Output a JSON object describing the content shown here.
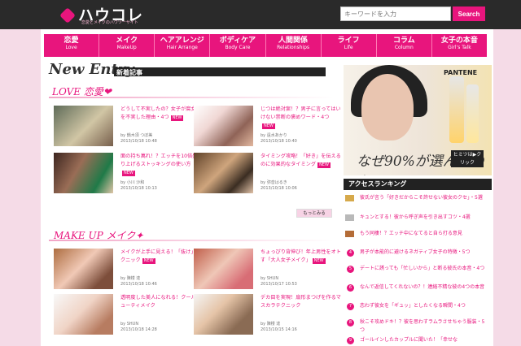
{
  "site": {
    "logo": "ハウコレ",
    "tagline": "恋愛とメイクのハウツーサイト",
    "search_placeholder": "キーワードを入力",
    "search_button": "Search"
  },
  "nav": [
    {
      "jp": "恋愛",
      "en": "Love"
    },
    {
      "jp": "メイク",
      "en": "MakeUp"
    },
    {
      "jp": "ヘアアレンジ",
      "en": "Hair Arrange"
    },
    {
      "jp": "ボディケア",
      "en": "Body Care"
    },
    {
      "jp": "人間関係",
      "en": "Relationships"
    },
    {
      "jp": "ライフ",
      "en": "Life"
    },
    {
      "jp": "コラム",
      "en": "Column"
    },
    {
      "jp": "女子の本音",
      "en": "Girl's Talk"
    }
  ],
  "new_entry": {
    "title": "New Entry",
    "subtitle": "新着記事"
  },
  "love": {
    "label": "LOVE 恋愛❤",
    "more": "もっとみる",
    "articles": [
      {
        "title": "どうして不実したの？女子が腐女子を不実した理由・4つ",
        "meta": "by 鍋木須 つぼ美\n2013/10/18 10:48",
        "new": "NEW"
      },
      {
        "title": "じつは絶対案！？男子に言ってはいけない禁断の褒めワード・4つ",
        "meta": "by 遠水あかり\n2013/10/18 10:40",
        "new": "NEW"
      },
      {
        "title": "面の持ち萬れ！？エッチを10倍盛り上げるストッキングの使い方",
        "meta": "by 小川 沙和\n2013/10/18 10:13",
        "new": "NEW"
      },
      {
        "title": "タイミング攻略！「好き」を伝えるのに効果的なタイミング",
        "meta": "by 弥音はるき\n2013/10/18 10:06",
        "new": "NEW"
      }
    ]
  },
  "makeup": {
    "label": "MAKE UP メイク✦",
    "articles": [
      {
        "title": "メイクが上手に見える！「抜け」テクニック",
        "meta": "by 陳楼 達\n2013/10/18 10:46",
        "new": "NEW"
      },
      {
        "title": "ちょっぴり背伸び！年上男性をオトす「大人女子メイク」",
        "meta": "by SHUN\n2013/10/17 10:53",
        "new": "NEW"
      },
      {
        "title": "透明度した美人になれる！クールビューティメイク",
        "meta": "by SHUN\n2013/10/18 14:28",
        "new": ""
      },
      {
        "title": "デカ目を実現！扇形まつげを作るマスカラテクニック",
        "meta": "by 陳楼 達\n2013/10/15 14:16",
        "new": ""
      }
    ]
  },
  "banner": {
    "brand": "PANTENE",
    "copy": "なぜ90%が選んだのか",
    "button": "ヒミツは▶クリック"
  },
  "ranking": {
    "title": "アクセスランキング",
    "items": [
      "彼氏が言う「好きだからこそ許せない彼女のクセ」・5選",
      "キュンとする！彼から呼ぎ声を引き出すコツ・4選",
      "もう同棲！？エッチ中になてると自ら打る意見",
      "男子が本能的に避けるネガティブ女子の特徴・5つ",
      "デートに誘っても「忙しいから」と断る彼氏の本音・4つ",
      "なんで返信してくれないの？！連絡不精な彼の4つの本音",
      "恋わず彼女を「ギュッ」としたくなる瞬間・4つ",
      "秋こそ攻めドキ！？彼を思わすラムラさせちゃう服装・5つ",
      "ゴールインしたカップルに聞いた！「幸せな"
    ]
  },
  "colors": {
    "accent": "#e8157d",
    "background": "#f5dbe7"
  }
}
